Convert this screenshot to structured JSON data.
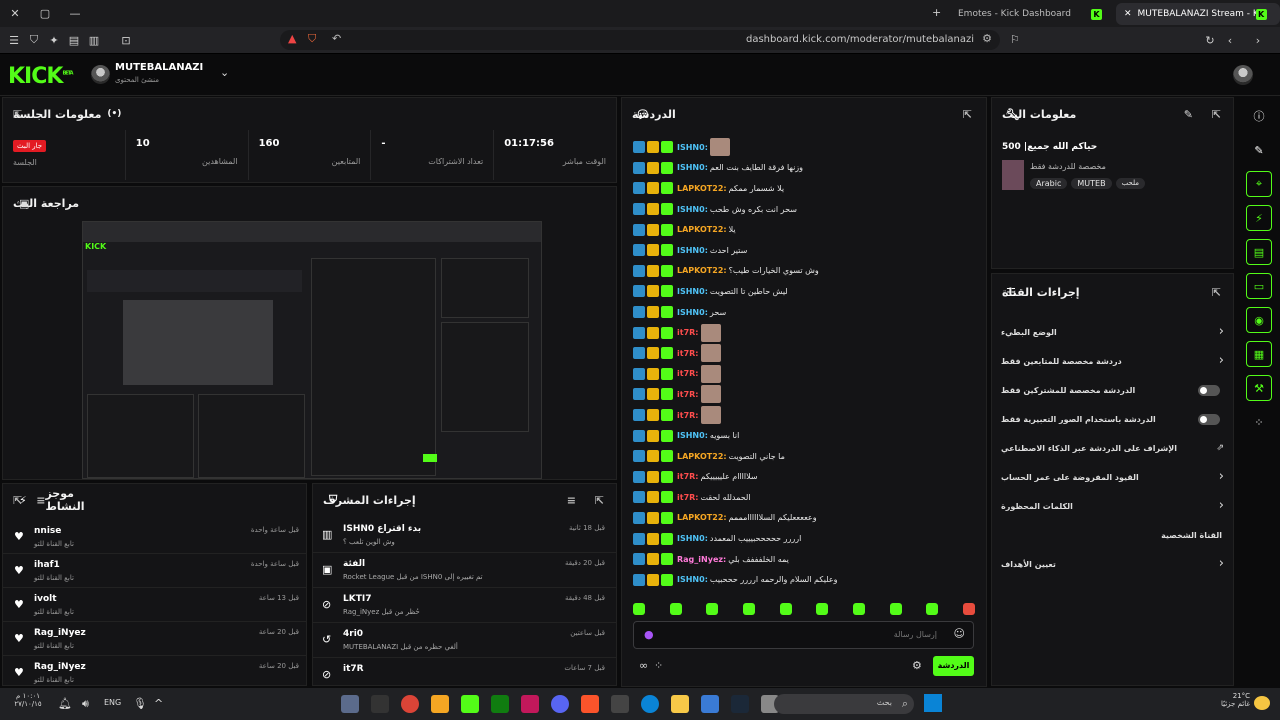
{
  "browser": {
    "tabs": [
      {
        "title": "Emotes - Kick Dashboard"
      },
      {
        "title": "MUTEBALANAZI Stream - Kick Dashboard"
      }
    ],
    "url": "dashboard.kick.com/moderator/mutebalanazi"
  },
  "header": {
    "logo": "KICK",
    "logo_sup": "BETA",
    "channel_name": "MUTEBALANAZI",
    "channel_role": "منشئ المحتوى"
  },
  "session": {
    "title": "معلومات الجلسة",
    "stats": [
      {
        "value": "01:17:56",
        "label": "الوقت مباشر"
      },
      {
        "value": "-",
        "label": "تعداد الاشتراكات"
      },
      {
        "value": "160",
        "label": "المتابعين"
      },
      {
        "value": "10",
        "label": "المشاهدين"
      },
      {
        "value": "جار البث",
        "label": "الجلسة"
      }
    ]
  },
  "stream_preview": {
    "title": "مراجعة البث"
  },
  "activity": {
    "title": "موجز النشاط",
    "items": [
      {
        "name": "nnise",
        "sub": "تابع القناة للتو",
        "time": "قبل ساعة واحدة"
      },
      {
        "name": "ihaf1",
        "sub": "تابع القناة للتو",
        "time": "قبل ساعة واحدة"
      },
      {
        "name": "ivolt",
        "sub": "تابع القناة للتو",
        "time": "قبل 13 ساعة"
      },
      {
        "name": "Rag_iNyez",
        "sub": "تابع القناة للتو",
        "time": "قبل 20 ساعة"
      },
      {
        "name": "Rag_iNyez",
        "sub": "تابع القناة للتو",
        "time": "قبل 20 ساعة"
      }
    ]
  },
  "mod_actions": {
    "title": "إجراءات المشرف",
    "items": [
      {
        "title": "ISHN0 بدء اقتراع",
        "sub": "وش الوين تلعب ؟",
        "time": "قبل 18 ثانية"
      },
      {
        "title": "الفئة",
        "sub": "Rocket League من قبل ISHN0 تم تغييره إلى",
        "time": "قبل 20 دقيقة"
      },
      {
        "title": "LKTI7",
        "sub": "Rag_iNyez حُظر من قبل",
        "time": "قبل 48 دقيقة"
      },
      {
        "title": "4ri0",
        "sub": "MUTEBALANAZI ألغي حظره من قبل",
        "time": "قبل ساعتين"
      },
      {
        "title": "it7R",
        "sub": "",
        "time": "قبل 7 ساعات"
      }
    ]
  },
  "chat": {
    "title": "الدردشة",
    "placeholder": "إرسال رسالة",
    "send_label": "الدردشة",
    "messages": [
      {
        "user": "ISHN0:",
        "color": "#4fc3f7",
        "text": "",
        "img": true
      },
      {
        "user": "ISHN0:",
        "color": "#4fc3f7",
        "text": "وزنها فرقة الطايف بنت العم"
      },
      {
        "user": "LAPKOT22:",
        "color": "#f5a623",
        "text": "يلا شسمار ممكم"
      },
      {
        "user": "ISHN0:",
        "color": "#4fc3f7",
        "text": "سحر انت بكره وش طحب"
      },
      {
        "user": "LAPKOT22:",
        "color": "#f5a623",
        "text": "يلا"
      },
      {
        "user": "ISHN0:",
        "color": "#4fc3f7",
        "text": "ستير احدث"
      },
      {
        "user": "LAPKOT22:",
        "color": "#f5a623",
        "text": "وش تسوي الخيارات طيب؟"
      },
      {
        "user": "ISHN0:",
        "color": "#4fc3f7",
        "text": "ليش حاطين تا التصويت"
      },
      {
        "user": "ISHN0:",
        "color": "#4fc3f7",
        "text": "سحر"
      },
      {
        "user": "it7R:",
        "color": "#ff4d4d",
        "text": "",
        "img": true
      },
      {
        "user": "it7R:",
        "color": "#ff4d4d",
        "text": "",
        "img": true
      },
      {
        "user": "it7R:",
        "color": "#ff4d4d",
        "text": "",
        "img": true
      },
      {
        "user": "it7R:",
        "color": "#ff4d4d",
        "text": "",
        "img": true
      },
      {
        "user": "it7R:",
        "color": "#ff4d4d",
        "text": "",
        "img": true
      },
      {
        "user": "ISHN0:",
        "color": "#4fc3f7",
        "text": "انا بسويه"
      },
      {
        "user": "LAPKOT22:",
        "color": "#f5a623",
        "text": "ما جاني التصويت"
      },
      {
        "user": "it7R:",
        "color": "#ff4d4d",
        "text": "سلااااام عليييييكم"
      },
      {
        "user": "it7R:",
        "color": "#ff4d4d",
        "text": "الحمدلله لحقت"
      },
      {
        "user": "LAPKOT22:",
        "color": "#f5a623",
        "text": "وعععععليكم السلاااااامممم"
      },
      {
        "user": "ISHN0:",
        "color": "#4fc3f7",
        "text": "ارررر حححححبيييب المعمدد"
      },
      {
        "user": "Rag_iNyez:",
        "color": "#ff7ad9",
        "text": "يمه الخلفففف بلي"
      },
      {
        "user": "ISHN0:",
        "color": "#4fc3f7",
        "text": "وعليكم السلام والرحمه ارررر حححبيب"
      }
    ]
  },
  "stream_info": {
    "title": "معلومات البث",
    "stream_title": "حياكم الله جميع| 500",
    "category": "مخصصة للدردشة فقط",
    "tags": [
      "Arabic",
      "MUTEB",
      "ملحب"
    ]
  },
  "channel_actions": {
    "title": "إجراءات القناة",
    "rows": [
      {
        "label": "الوضع البطيء",
        "type": "chevron"
      },
      {
        "label": "دردشة مخصصة للمتابعين فقط",
        "type": "chevron"
      },
      {
        "label": "الدردشة مخصصة للمشتركين فقط",
        "type": "toggle"
      },
      {
        "label": "الدردشة باستخدام الصور التعبيرية فقط",
        "type": "toggle"
      },
      {
        "label": "الإشراف على الدردشة عبر الذكاء الاصطناعي",
        "type": "external"
      },
      {
        "label": "القيود المفروضة على عمر الحساب",
        "type": "chevron"
      },
      {
        "label": "الكلمات المحظورة",
        "type": "chevron"
      },
      {
        "label": "القناة الشخصية",
        "type": "none"
      },
      {
        "label": "تعيين الأهداف",
        "type": "chevron"
      }
    ]
  },
  "taskbar": {
    "lang": "ENG",
    "time": "١٠:٠١ م",
    "date": "٢٧/١٠/١٥",
    "search": "بحث",
    "weather_temp": "21°C",
    "weather_desc": "غائم جزئيًا"
  }
}
